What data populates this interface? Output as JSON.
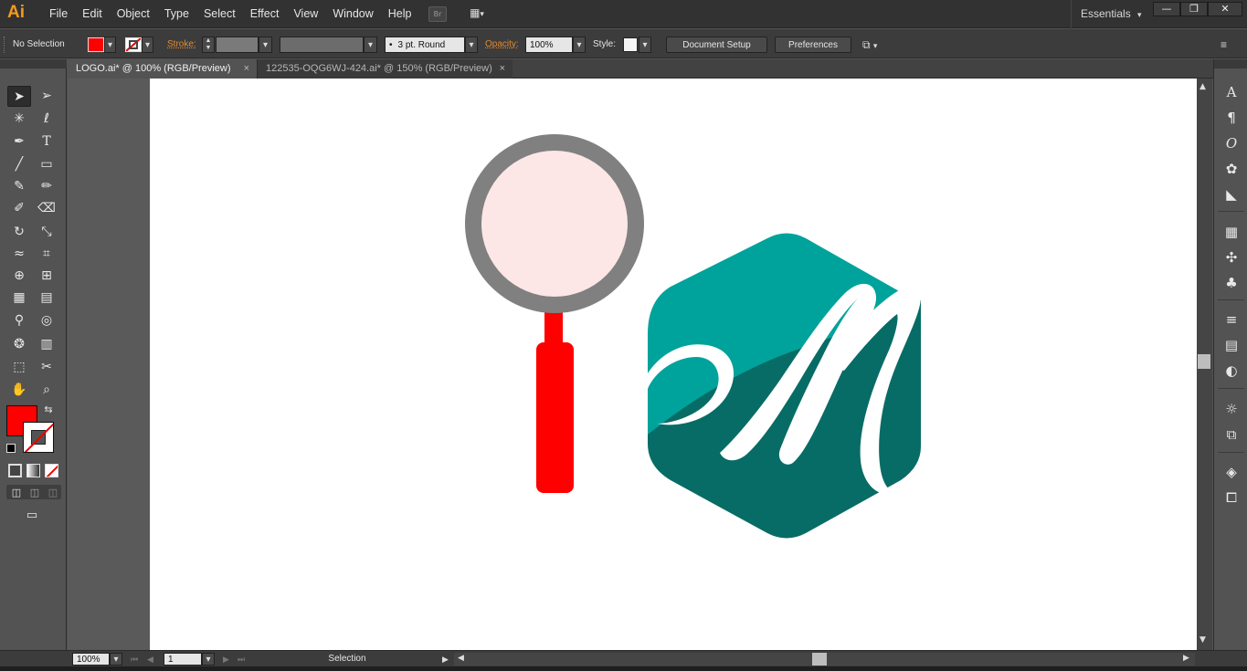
{
  "app": {
    "logo": "Ai",
    "workspace": "Essentials"
  },
  "menu": [
    "File",
    "Edit",
    "Object",
    "Type",
    "Select",
    "Effect",
    "View",
    "Window",
    "Help"
  ],
  "menubar": {
    "bridge_label": "Br",
    "arrange_arrow": "▾",
    "essentials_arrow": "▾"
  },
  "window_controls": {
    "minimize": "—",
    "restore": "❐",
    "close": "✕"
  },
  "control_bar": {
    "selection_status": "No Selection",
    "fill_color": "#ff0000",
    "stroke_label": "Stroke:",
    "stroke_profile": "3 pt. Round",
    "stroke_profile_bullet": "•",
    "opacity_label": "Opacity:",
    "opacity_value": "100%",
    "style_label": "Style:",
    "document_setup": "Document Setup",
    "preferences": "Preferences",
    "dropdown_arrow": "▾"
  },
  "tabs": [
    {
      "title": "LOGO.ai* @ 100% (RGB/Preview)",
      "close": "×",
      "active": true
    },
    {
      "title": "122535-OQG6WJ-424.ai* @ 150% (RGB/Preview)",
      "close": "×",
      "active": false
    }
  ],
  "artwork": {
    "magnifier_ring": "#808080",
    "magnifier_lens": "#fde6e6",
    "magnifier_handle": "#ff0000",
    "hexagon_light": "#00a39b",
    "hexagon_dark": "#076c65",
    "letter_color": "#ffffff"
  },
  "status_bar": {
    "zoom": "100%",
    "artboard_number": "1",
    "current_tool": "Selection",
    "dropdown_arrow": "▾"
  },
  "tools": {
    "selection": "➤",
    "direct_selection": "➢",
    "magic_wand": "✳",
    "lasso": "ℓ",
    "pen": "✒",
    "type": "T",
    "line": "╱",
    "rectangle": "▭",
    "paintbrush": "✎",
    "pencil": "✏",
    "blob_brush": "✐",
    "eraser": "⌫",
    "rotate": "↻",
    "scale": "⤡",
    "warp": "≈",
    "free_transform": "⌗",
    "shape_builder": "⊕",
    "perspective": "⊞",
    "mesh": "▦",
    "gradient": "▤",
    "eyedropper": "⚲",
    "blend": "◎",
    "symbol_sprayer": "❂",
    "graph": "▥",
    "artboard": "⬚",
    "slice": "✂",
    "hand": "✋",
    "zoom": "⌕",
    "swap_arrow": "⇆",
    "draw_mode": "◫",
    "screen_mode": "▭"
  },
  "panels": {
    "character": "A",
    "paragraph": "¶",
    "opentype": "O",
    "color_guide": "✿",
    "color": "◣",
    "swatches": "▦",
    "brushes": "✣",
    "symbols": "♣",
    "stroke": "≡",
    "gradient": "▤",
    "transparency": "◐",
    "appearance": "☼",
    "graphic_styles": "⧉",
    "layers": "◈",
    "artboards": "⧠"
  }
}
